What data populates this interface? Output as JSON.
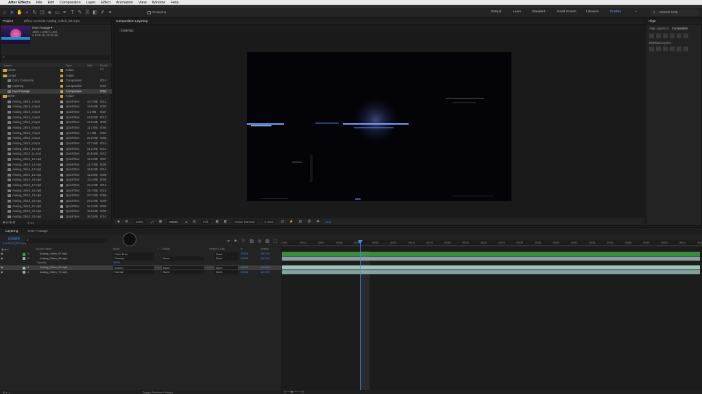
{
  "menubar": {
    "apple": "",
    "app": "After Effects",
    "items": [
      "File",
      "Edit",
      "Composition",
      "Layer",
      "Effect",
      "Animation",
      "View",
      "Window",
      "Help"
    ]
  },
  "toolbar": {
    "snapping": "Snapping",
    "workspaces": [
      "Default",
      "Learn",
      "Standard",
      "Small Screen",
      "Libraries"
    ],
    "workspace_active": "ProRes",
    "search_placeholder": "Search Help"
  },
  "project": {
    "tab_project": "Project",
    "tab_effect_controls": "Effect Controls Analog_Glitch_69.mp4",
    "item_name": "Over Footage▼",
    "item_info1": "1920 x 1080 (1.00)",
    "item_info2": "Δ 0;00;48, 30.00 fps",
    "search_placeholder": "⌕",
    "columns": {
      "name": "Name",
      "type": "Type",
      "size": "Size",
      "dur": "Media Du"
    },
    "rows": [
      {
        "name": "Assets",
        "type": "Folder",
        "size": "",
        "dur": "",
        "folder": true,
        "color": "#c9a24a",
        "sel": false
      },
      {
        "name": "Comps",
        "type": "Folder",
        "size": "",
        "dur": "",
        "folder": true,
        "color": "#c9a24a",
        "sel": false
      },
      {
        "name": "Color Customize",
        "type": "Composition",
        "size": "",
        "dur": "0014",
        "folder": false,
        "color": "#c9a24a",
        "sel": false
      },
      {
        "name": "Layering",
        "type": "Composition",
        "size": "",
        "dur": "0004",
        "folder": false,
        "color": "#c9a24a",
        "sel": false
      },
      {
        "name": "Over Footage",
        "type": "Composition",
        "size": "",
        "dur": "0004",
        "folder": false,
        "color": "#c9a24a",
        "sel": true
      },
      {
        "name": "HEVC",
        "type": "Folder",
        "size": "",
        "dur": "",
        "folder": true,
        "color": "#c9a24a",
        "sel": false
      },
      {
        "name": "Analog_Glitch_1.mp4",
        "type": "QuickTime",
        "size": "24.7 MB",
        "dur": "0012",
        "folder": false,
        "color": "#9c9c9c",
        "sel": false
      },
      {
        "name": "Analog_Glitch_2.mp4",
        "type": "QuickTime",
        "size": "13.9 MB",
        "dur": "0004",
        "folder": false,
        "color": "#9c9c9c",
        "sel": false
      },
      {
        "name": "Analog_Glitch_3.mp4",
        "type": "QuickTime",
        "size": "4.3 MB",
        "dur": "0007",
        "folder": false,
        "color": "#9c9c9c",
        "sel": false
      },
      {
        "name": "Analog_Glitch_4.mp4",
        "type": "QuickTime",
        "size": "24.5 MB",
        "dur": "0012",
        "folder": false,
        "color": "#9c9c9c",
        "sel": false
      },
      {
        "name": "Analog_Glitch_5.mp4",
        "type": "QuickTime",
        "size": "13.5 MB",
        "dur": "0008",
        "folder": false,
        "color": "#9c9c9c",
        "sel": false
      },
      {
        "name": "Analog_Glitch_6.mp4",
        "type": "QuickTime",
        "size": "11.3 MB",
        "dur": "0004",
        "folder": false,
        "color": "#9c9c9c",
        "sel": false
      },
      {
        "name": "Analog_Glitch_7.mp4",
        "type": "QuickTime",
        "size": "4.4 MB",
        "dur": "0001",
        "folder": false,
        "color": "#9c9c9c",
        "sel": false
      },
      {
        "name": "Analog_Glitch_8.mp4",
        "type": "QuickTime",
        "size": "25.2 MB",
        "dur": "0008",
        "folder": false,
        "color": "#9c9c9c",
        "sel": false
      },
      {
        "name": "Analog_Glitch_9.mp4",
        "type": "QuickTime",
        "size": "47.7 MB",
        "dur": "0014",
        "folder": false,
        "color": "#9c9c9c",
        "sel": false
      },
      {
        "name": "Analog_Glitch_10.mp4",
        "type": "QuickTime",
        "size": "31.2 MB",
        "dur": "0014",
        "folder": false,
        "color": "#9c9c9c",
        "sel": false
      },
      {
        "name": "Analog_Glitch_11.mp4",
        "type": "QuickTime",
        "size": "90.5 MB",
        "dur": "0012",
        "folder": false,
        "color": "#9c9c9c",
        "sel": false
      },
      {
        "name": "Analog_Glitch_12.mp4",
        "type": "QuickTime",
        "size": "12.2 MB",
        "dur": "0007",
        "folder": false,
        "color": "#9c9c9c",
        "sel": false
      },
      {
        "name": "Analog_Glitch_13.mp4",
        "type": "QuickTime",
        "size": "21.7 MB",
        "dur": "0005",
        "folder": false,
        "color": "#9c9c9c",
        "sel": false
      },
      {
        "name": "Analog_Glitch_14.mp4",
        "type": "QuickTime",
        "size": "38.5 MB",
        "dur": "0014",
        "folder": false,
        "color": "#9c9c9c",
        "sel": false
      },
      {
        "name": "Analog_Glitch_15.mp4",
        "type": "QuickTime",
        "size": "11.5 MB",
        "dur": "0008",
        "folder": false,
        "color": "#9c9c9c",
        "sel": false
      },
      {
        "name": "Analog_Glitch_16.mp4",
        "type": "QuickTime",
        "size": "15.2 MB",
        "dur": "0008",
        "folder": false,
        "color": "#9c9c9c",
        "sel": false
      },
      {
        "name": "Analog_Glitch_17.mp4",
        "type": "QuickTime",
        "size": "34.4 MB",
        "dur": "0014",
        "folder": false,
        "color": "#9c9c9c",
        "sel": false
      },
      {
        "name": "Analog_Glitch_18.mp4",
        "type": "QuickTime",
        "size": "29.7 MB",
        "dur": "0014",
        "folder": false,
        "color": "#9c9c9c",
        "sel": false
      },
      {
        "name": "Analog_Glitch_19.mp4",
        "type": "QuickTime",
        "size": "25.7 MB",
        "dur": "0008",
        "folder": false,
        "color": "#9c9c9c",
        "sel": false
      },
      {
        "name": "Analog_Glitch_20.mp4",
        "type": "QuickTime",
        "size": "29.2 MB",
        "dur": "0009",
        "folder": false,
        "color": "#9c9c9c",
        "sel": false
      },
      {
        "name": "Analog_Glitch_21.mp4",
        "type": "QuickTime",
        "size": "32.3 MB",
        "dur": "0009",
        "folder": false,
        "color": "#9c9c9c",
        "sel": false
      },
      {
        "name": "Analog_Glitch_22.mp4",
        "type": "QuickTime",
        "size": "18.5 MB",
        "dur": "0005",
        "folder": false,
        "color": "#9c9c9c",
        "sel": false
      },
      {
        "name": "Analog_Glitch_23.mp4",
        "type": "QuickTime",
        "size": "38.3 MB",
        "dur": "0014",
        "folder": false,
        "color": "#9c9c9c",
        "sel": false
      }
    ],
    "footer_bpc": "8 bpc"
  },
  "viewer": {
    "tab": "Composition Layering",
    "breadcrumb": "Layering",
    "zoom": "100%",
    "timecode": "00009",
    "resolution": "Full",
    "camera": "Active Camera",
    "views": "1 View",
    "exposure": "+0.0"
  },
  "align": {
    "title": "Align",
    "align_to_label": "Align Layers to:",
    "align_to_value": "Composition",
    "distribute_label": "Distribute Layers:"
  },
  "timeline": {
    "tab_active": "Layering",
    "tab_other": "Over Footage",
    "timecode": "00009",
    "timecode_sub": "0:00:00:09 (30.00 fps)",
    "search_placeholder": "⌕",
    "columns": {
      "name": "Source Name",
      "mode": "Mode",
      "t": "T",
      "trkmat": "TrkMat",
      "parent": "Parent & Link",
      "in": "In",
      "stretch": "Stretch"
    },
    "ruler_labels": [
      "0000",
      "00002",
      "00004",
      "00006",
      "00008",
      "00010",
      "00012",
      "00014",
      "00016",
      "00018",
      "00020",
      "00022",
      "00024",
      "00026",
      "00028",
      "00030",
      "00032",
      "00034",
      "00036",
      "00038",
      "00040",
      "00042",
      "00044",
      "00046"
    ],
    "layers": [
      {
        "num": "1",
        "name": "Analog_Glitch_67.mp4",
        "mode": "Color Burn",
        "trkmat": "",
        "parent": "None",
        "in": "00000",
        "stretch": "100.0%",
        "color": "#3fa143",
        "sel": false,
        "sub": false
      },
      {
        "num": "2",
        "name": "Analog_Glitch_68.mp4",
        "mode": "Overlay",
        "trkmat": "None",
        "parent": "None",
        "in": "00000",
        "stretch": "100.0%",
        "color": "#9ab7b4",
        "sel": false,
        "sub": false
      },
      {
        "num": "",
        "name": "Opacity",
        "mode": "100%",
        "trkmat": "",
        "parent": "",
        "in": "",
        "stretch": "",
        "color": "",
        "sel": false,
        "sub": true
      },
      {
        "num": "3",
        "name": "Analog_Glitch_69.mp4",
        "mode": "Screen",
        "trkmat": "None",
        "parent": "None",
        "in": "00000",
        "stretch": "100.0%",
        "color": "#9ac3b9",
        "sel": true,
        "sub": false
      },
      {
        "num": "4",
        "name": "Analog_Glitch_70.mp4",
        "mode": "Normal",
        "trkmat": "None",
        "parent": "None",
        "in": "00000",
        "stretch": "100.0%",
        "color": "#9ab7b4",
        "sel": false,
        "sub": false
      }
    ],
    "footer": "Toggle Switches / Modes"
  }
}
